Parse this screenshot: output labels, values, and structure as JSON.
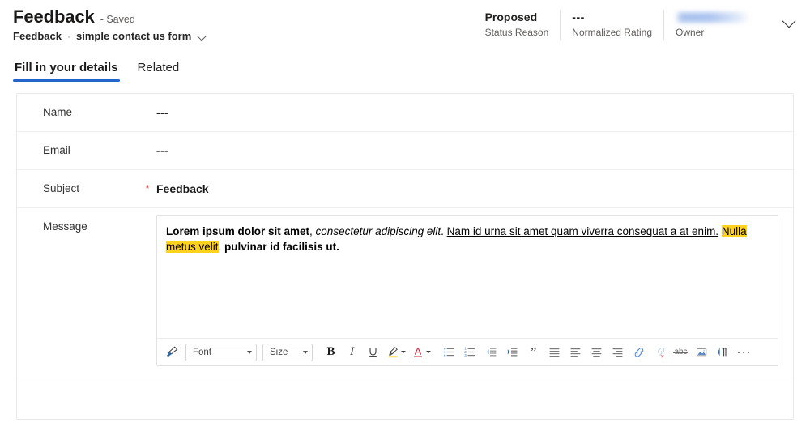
{
  "header": {
    "record_title": "Feedback",
    "saved_state": "- Saved",
    "breadcrumb": {
      "entity": "Feedback",
      "separator": "·",
      "form_name": "simple contact us form",
      "chevron_icon": "chevron-down-icon"
    },
    "stats": [
      {
        "value": "Proposed",
        "label": "Status Reason"
      },
      {
        "value": "---",
        "label": "Normalized Rating"
      }
    ],
    "owner_stat": {
      "value": "",
      "label": "Owner",
      "redacted": true
    },
    "expand_icon": "chevron-down-icon"
  },
  "tabs": [
    {
      "label": "Fill in your details",
      "active": true
    },
    {
      "label": "Related",
      "active": false
    }
  ],
  "form": {
    "fields": [
      {
        "label": "Name",
        "value": "---",
        "required": false,
        "style": "dashes"
      },
      {
        "label": "Email",
        "value": "---",
        "required": false,
        "style": "dashes"
      },
      {
        "label": "Subject",
        "value": "Feedback",
        "required": true,
        "required_marker": "*",
        "style": "text"
      },
      {
        "label": "Message",
        "value": "",
        "required": false,
        "style": "richtext"
      }
    ]
  },
  "editor": {
    "content": {
      "bold_lead": "Lorem ipsum dolor sit amet",
      "comma_after_lead": ", ",
      "italic_part": "consectetur adipiscing elit",
      "period_after_italic": ". ",
      "underline_part": "Nam id urna sit amet quam viverra consequat a at enim.",
      "space_after_underline": " ",
      "highlight_part": "Nulla metus velit",
      "comma_after_highlight": ", ",
      "bold_tail": "pulvinar id facilisis ut."
    },
    "toolbar": {
      "format_painter": {
        "name": "format-painter-icon",
        "title": "Format painter"
      },
      "font_combo": {
        "label": "Font",
        "name": "font-family-dropdown"
      },
      "size_combo": {
        "label": "Size",
        "name": "font-size-dropdown"
      },
      "bold": {
        "glyph": "B",
        "name": "bold-button"
      },
      "italic": {
        "glyph": "I",
        "name": "italic-button"
      },
      "underline": {
        "glyph": "U",
        "name": "underline-button"
      },
      "highlight": {
        "name": "highlight-color-button"
      },
      "font_color": {
        "glyph": "A",
        "name": "font-color-button"
      },
      "bulleted_list": {
        "name": "bulleted-list-button"
      },
      "numbered_list": {
        "name": "numbered-list-button"
      },
      "decrease_indent": {
        "name": "decrease-indent-button"
      },
      "increase_indent": {
        "name": "increase-indent-button"
      },
      "blockquote": {
        "glyph": "”",
        "name": "blockquote-button"
      },
      "align_justify": {
        "name": "align-justify-button"
      },
      "align_left": {
        "name": "align-left-button"
      },
      "align_center": {
        "name": "align-center-button"
      },
      "align_right": {
        "name": "align-right-button"
      },
      "insert_link": {
        "name": "insert-link-button"
      },
      "remove_link": {
        "name": "remove-link-button"
      },
      "strikethrough": {
        "glyph": "abc",
        "name": "strikethrough-button"
      },
      "insert_image": {
        "name": "insert-image-button"
      },
      "text_direction": {
        "name": "text-direction-button"
      },
      "more_options": {
        "glyph": "···",
        "name": "more-options-button"
      }
    }
  },
  "colors": {
    "accent_blue": "#2266cc",
    "highlight_yellow": "#FFD21E",
    "required_red": "#d13438",
    "label_gray": "#605e5c",
    "border_gray": "#e8e8e8"
  }
}
